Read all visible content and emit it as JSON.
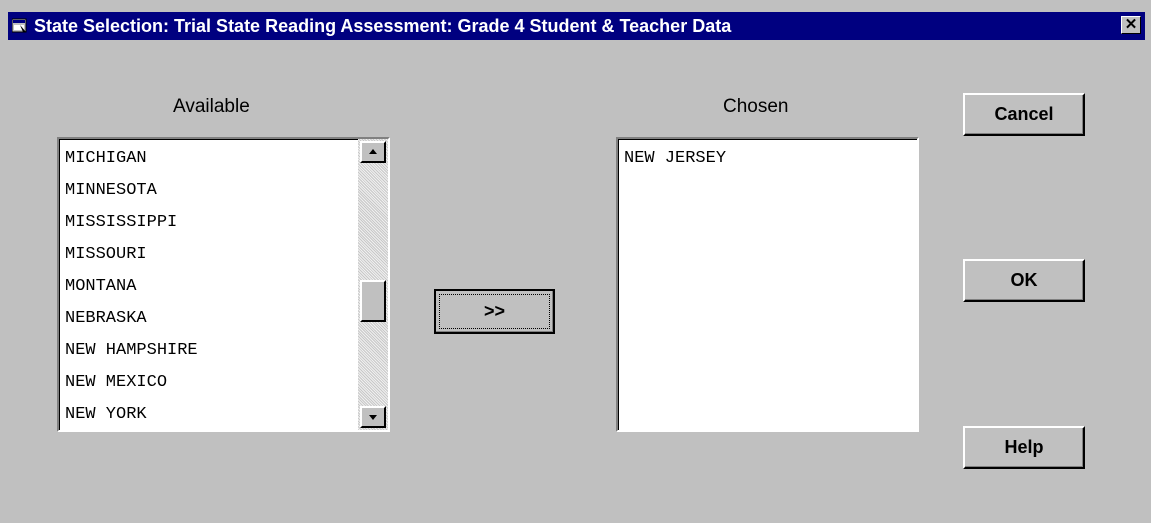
{
  "window": {
    "title": "State Selection: Trial State Reading Assessment: Grade 4 Student & Teacher Data",
    "close_label": "✕"
  },
  "available": {
    "label": "Available",
    "items": [
      "MICHIGAN",
      "MINNESOTA",
      "MISSISSIPPI",
      "MISSOURI",
      "MONTANA",
      "NEBRASKA",
      "NEW HAMPSHIRE",
      "NEW MEXICO",
      "NEW YORK"
    ]
  },
  "move_button": {
    "label": ">>"
  },
  "chosen": {
    "label": "Chosen",
    "items": [
      "NEW JERSEY"
    ]
  },
  "buttons": {
    "cancel": "Cancel",
    "ok": "OK",
    "help": "Help"
  },
  "icons": {
    "app": "window-app-icon",
    "close": "close-icon",
    "scroll_up": "arrow-up-icon",
    "scroll_down": "arrow-down-icon"
  }
}
